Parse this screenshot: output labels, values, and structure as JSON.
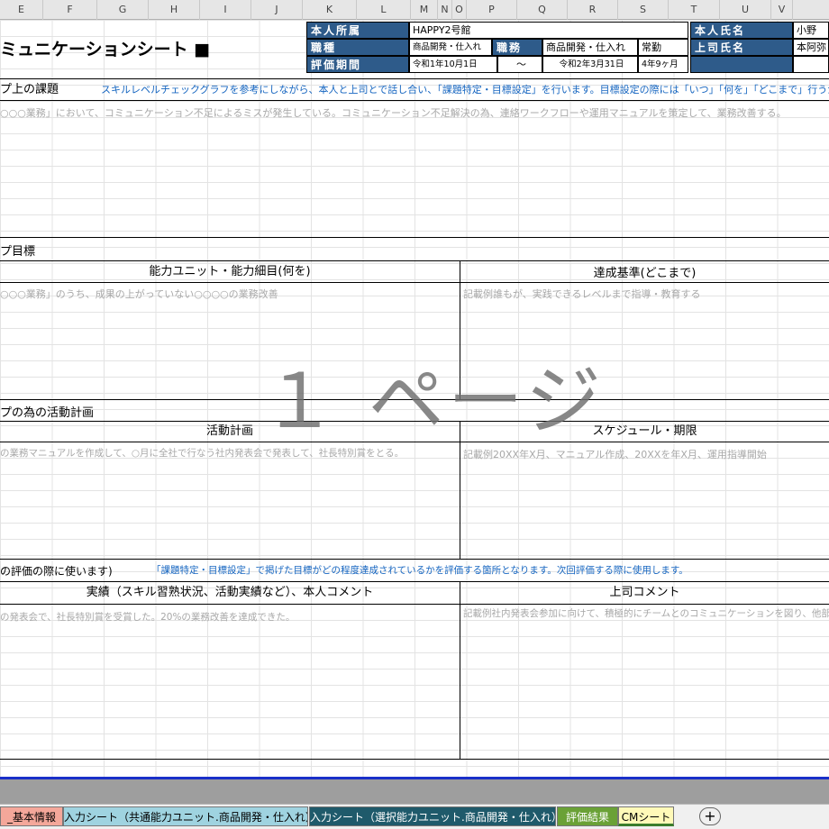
{
  "columns": [
    "E",
    "F",
    "G",
    "H",
    "I",
    "J",
    "K",
    "L",
    "M",
    "N",
    "O",
    "P",
    "Q",
    "R",
    "S",
    "T",
    "U",
    "V"
  ],
  "sheet": {
    "title": "ミュニケーションシート ■"
  },
  "info": {
    "dept_label": "本人所属",
    "dept_value": "HAPPY2号館",
    "job_label": "職種",
    "job_value": "商品開発・仕入れ",
    "duty_label": "職務",
    "duty_value": "商品開発・仕入れ",
    "employment": "常勤",
    "period_label": "評価期間",
    "period_start": "令和1年10月1日",
    "period_sep": "～",
    "period_end": "令和2年3月31日",
    "period_length": "4年9ヶ月",
    "name_label": "本人氏名",
    "name_value": "小野",
    "boss_label": "上司氏名",
    "boss_value": "本阿弥"
  },
  "sections": {
    "issue_label": "プ上の課題",
    "issue_note": "スキルレベルチェックグラフを参考にしながら、本人と上司とで話し合い、「課題特定・目標設定」を行います。目標設定の際には「いつ」「何を」「どこまで」行うかを明らかにし、具体的な目標を",
    "issue_example": "○○○業務」において、コミュニケーション不足によるミスが発生している。コミュニケーション不足解決の為、連絡ワークフローや運用マニュアルを策定して、業務改善する。",
    "goal_label": "プ目標",
    "goal_col1": "能力ユニット・能力細目(何を)",
    "goal_col2": "達成基準(どこまで)",
    "goal_example1": "○○○業務」のうち、成果の上がっていない○○○○の業務改善",
    "goal_example2": "記載例誰もが、実践できるレベルまで指導・教育する",
    "plan_label": "プの為の活動計画",
    "plan_col1": "活動計画",
    "plan_col2": "スケジュール・期限",
    "plan_example1": "の業務マニュアルを作成して、○月に全社で行なう社内発表会で発表して、社長特別賞をとる。",
    "plan_example2": "記載例20XX年X月、マニュアル作成、20XXを年X月、運用指導開始",
    "eval_label": "の評価の際に使います)",
    "eval_note": "「課題特定・目標設定」で掲げた目標がどの程度達成されているかを評価する箇所となります。次回評価する際に使用します。",
    "eval_col1": "実績（スキル習熟状況、活動実績など）、本人コメント",
    "eval_col2": "上司コメント",
    "eval_example1": "の発表会で、社長特別賞を受賞した。20%の業務改善を達成できた。",
    "eval_example2": "記載例社内発表会参加に向けて、積極的にチームとのコミュニケーションを図り、他部署"
  },
  "watermark": "１ ページ",
  "tabs": [
    {
      "label": "_基本情報",
      "color": "#f4a79a"
    },
    {
      "label": "入力シート（共通能力ユニット.商品開発・仕入れ）",
      "color": "#9fd3e0"
    },
    {
      "label": "入力シート（選択能力ユニット.商品開発・仕入れ）",
      "color": "#1f5a6b"
    },
    {
      "label": "評価結果",
      "color": "#6aa136"
    },
    {
      "label": "CMシート",
      "color": "#fff9b8"
    }
  ],
  "add_sheet_icon": "plus-circle-icon"
}
